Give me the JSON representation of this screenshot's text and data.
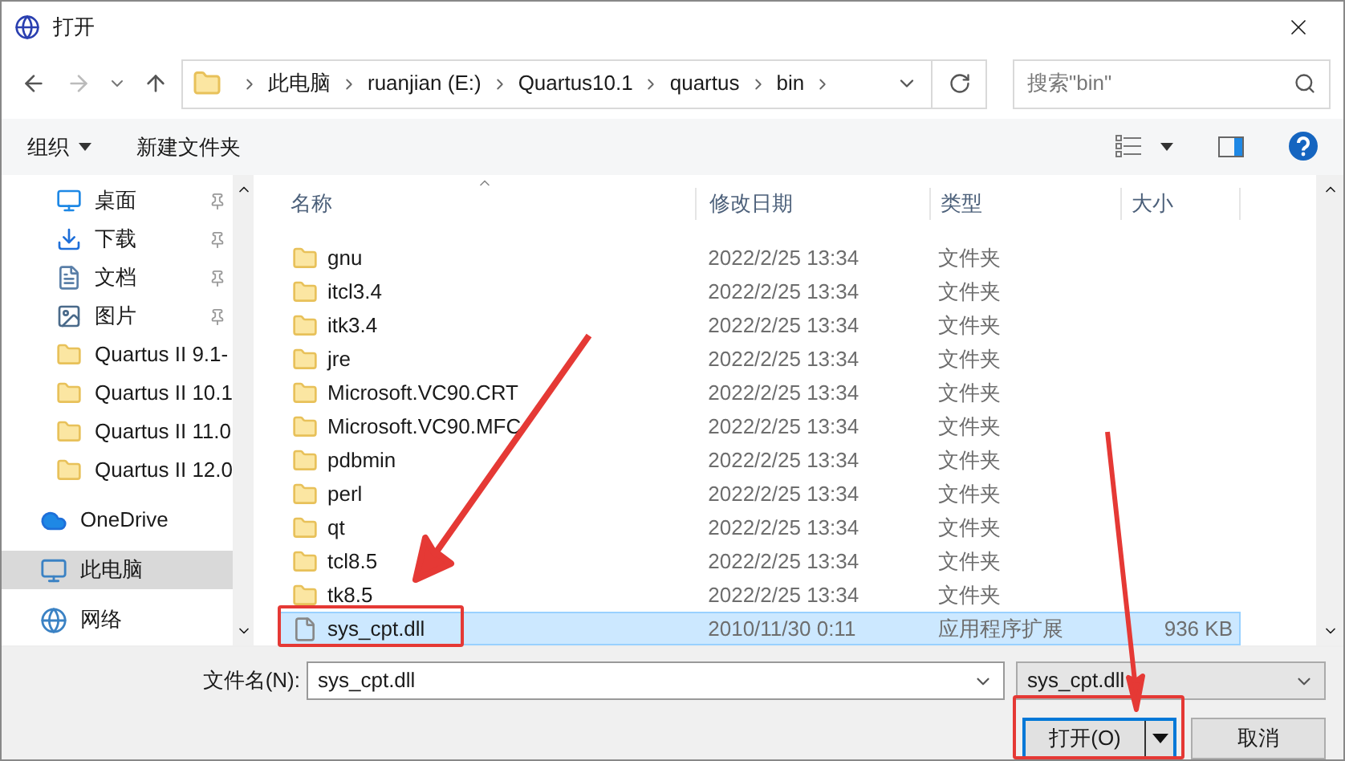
{
  "window": {
    "title": "打开"
  },
  "breadcrumb": [
    "此电脑",
    "ruanjian (E:)",
    "Quartus10.1",
    "quartus",
    "bin"
  ],
  "search": {
    "placeholder": "搜索\"bin\""
  },
  "toolbar": {
    "organize": "组织",
    "new_folder": "新建文件夹"
  },
  "sidebar": {
    "items": [
      {
        "label": "桌面",
        "kind": "desktop",
        "pinned": true,
        "selected": false
      },
      {
        "label": "下载",
        "kind": "download",
        "pinned": true,
        "selected": false
      },
      {
        "label": "文档",
        "kind": "document",
        "pinned": true,
        "selected": false
      },
      {
        "label": "图片",
        "kind": "picture",
        "pinned": true,
        "selected": false
      },
      {
        "label": "Quartus II 9.1-",
        "kind": "folder",
        "pinned": false,
        "selected": false
      },
      {
        "label": "Quartus II 10.1",
        "kind": "folder",
        "pinned": false,
        "selected": false
      },
      {
        "label": "Quartus II 11.0",
        "kind": "folder",
        "pinned": false,
        "selected": false
      },
      {
        "label": "Quartus II 12.0",
        "kind": "folder",
        "pinned": false,
        "selected": false
      },
      {
        "label": "OneDrive",
        "kind": "cloud",
        "pinned": false,
        "selected": false
      },
      {
        "label": "此电脑",
        "kind": "pc",
        "pinned": false,
        "selected": true
      },
      {
        "label": "网络",
        "kind": "network",
        "pinned": false,
        "selected": false
      }
    ]
  },
  "table": {
    "columns": [
      "名称",
      "修改日期",
      "类型",
      "大小"
    ],
    "rows": [
      {
        "name": "gnu",
        "date": "2022/2/25 13:34",
        "type": "文件夹",
        "kind": "folder",
        "selected": false
      },
      {
        "name": "itcl3.4",
        "date": "2022/2/25 13:34",
        "type": "文件夹",
        "kind": "folder",
        "selected": false
      },
      {
        "name": "itk3.4",
        "date": "2022/2/25 13:34",
        "type": "文件夹",
        "kind": "folder",
        "selected": false
      },
      {
        "name": "jre",
        "date": "2022/2/25 13:34",
        "type": "文件夹",
        "kind": "folder",
        "selected": false
      },
      {
        "name": "Microsoft.VC90.CRT",
        "date": "2022/2/25 13:34",
        "type": "文件夹",
        "kind": "folder",
        "selected": false
      },
      {
        "name": "Microsoft.VC90.MFC",
        "date": "2022/2/25 13:34",
        "type": "文件夹",
        "kind": "folder",
        "selected": false
      },
      {
        "name": "pdbmin",
        "date": "2022/2/25 13:34",
        "type": "文件夹",
        "kind": "folder",
        "selected": false
      },
      {
        "name": "perl",
        "date": "2022/2/25 13:34",
        "type": "文件夹",
        "kind": "folder",
        "selected": false
      },
      {
        "name": "qt",
        "date": "2022/2/25 13:34",
        "type": "文件夹",
        "kind": "folder",
        "selected": false
      },
      {
        "name": "tcl8.5",
        "date": "2022/2/25 13:34",
        "type": "文件夹",
        "kind": "folder",
        "selected": false
      },
      {
        "name": "tk8.5",
        "date": "2022/2/25 13:34",
        "type": "文件夹",
        "kind": "folder",
        "selected": false
      },
      {
        "name": "sys_cpt.dll",
        "date": "2010/11/30 0:11",
        "type": "应用程序扩展",
        "size": "936 KB",
        "kind": "file",
        "selected": true
      }
    ]
  },
  "filename": {
    "label": "文件名(N):",
    "value": "sys_cpt.dll"
  },
  "filter": {
    "value": "sys_cpt.dll"
  },
  "buttons": {
    "open": "打开(O)",
    "cancel": "取消"
  }
}
